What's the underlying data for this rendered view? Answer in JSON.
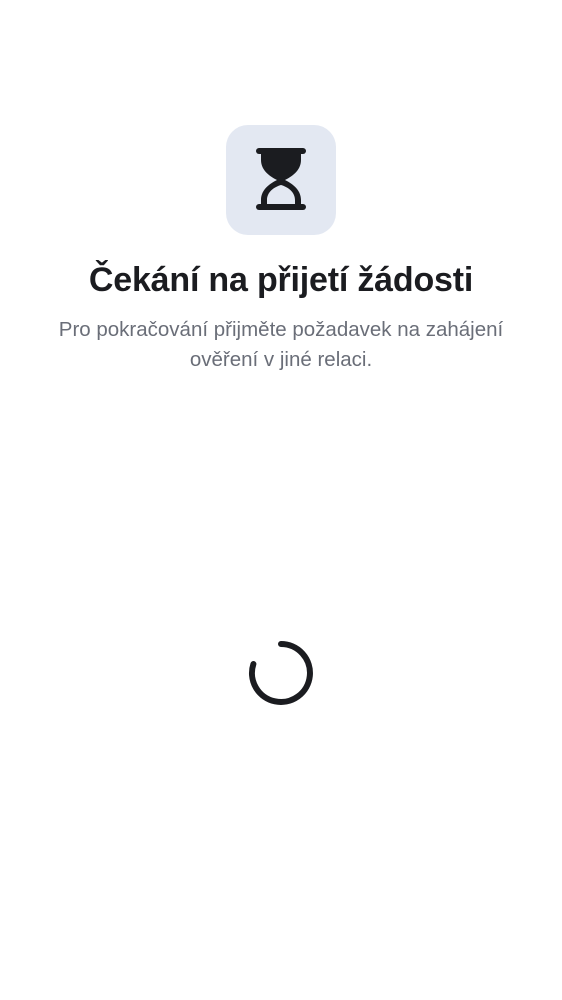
{
  "screen": {
    "icon": "hourglass-icon",
    "title": "Čekání na přijetí žádosti",
    "subtitle": "Pro pokračování přijměte požadavek na zahájení ověření v jiné relaci.",
    "loading_indicator": "spinner-icon"
  },
  "colors": {
    "background": "#ffffff",
    "icon_tile": "#e3e8f2",
    "title": "#1b1c20",
    "subtitle": "#6a6e78",
    "spinner": "#1b1c20"
  }
}
